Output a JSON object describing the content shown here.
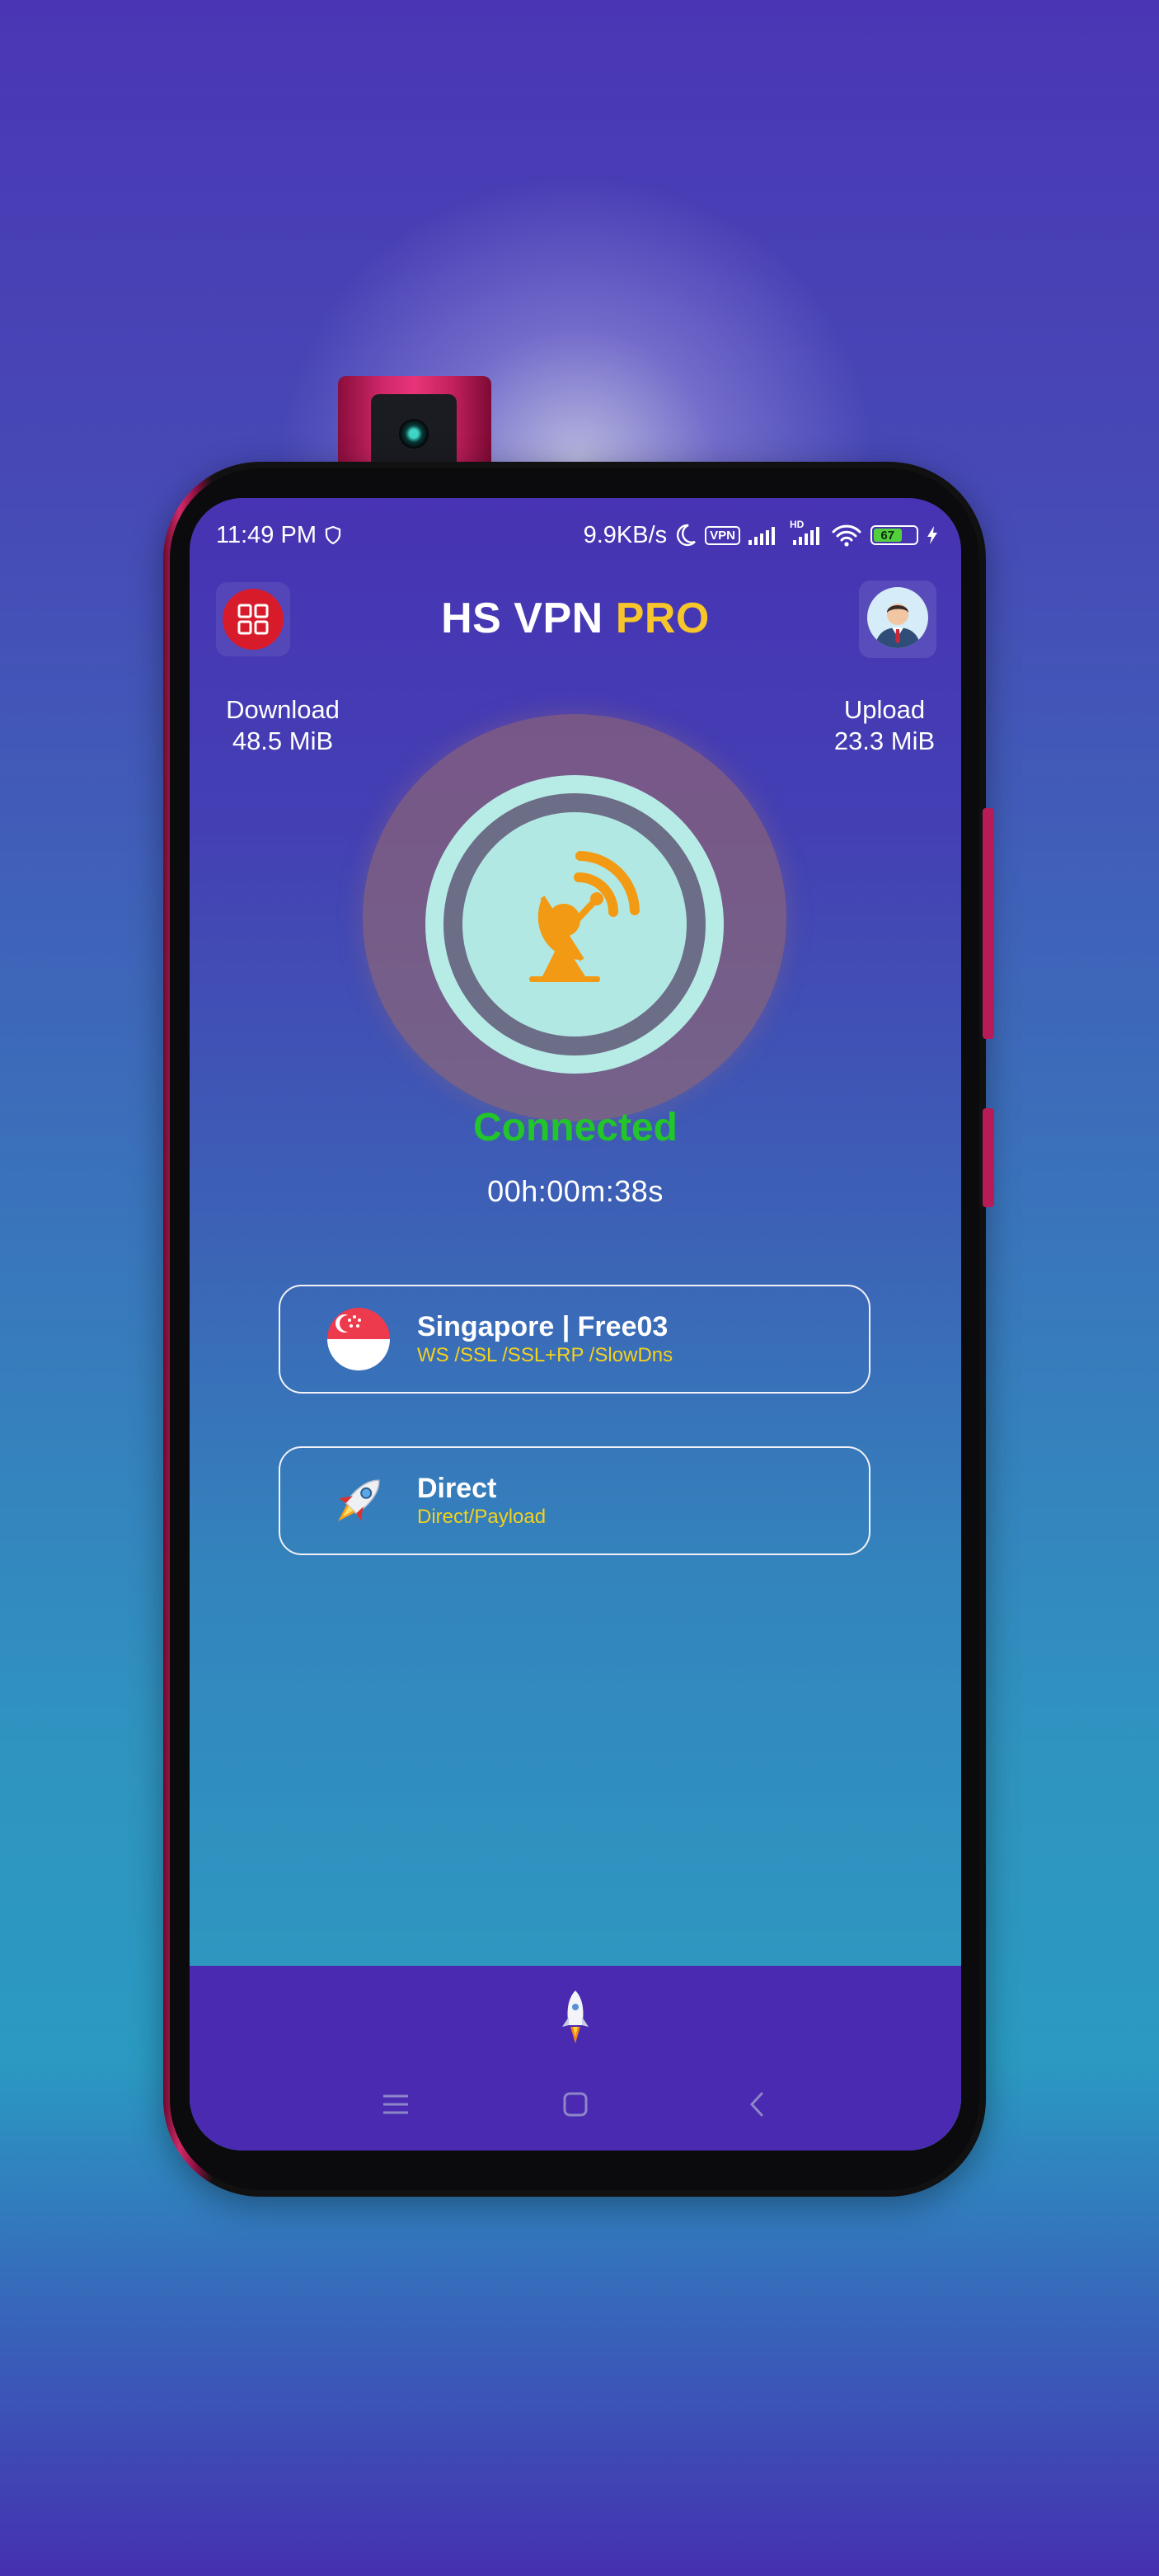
{
  "status_bar": {
    "time": "11:49 PM",
    "network_speed": "9.9KB/s",
    "vpn_badge": "VPN",
    "hd_label": "HD",
    "battery_level": "67"
  },
  "header": {
    "title_main": "HS VPN",
    "title_accent": "PRO"
  },
  "stats": {
    "download_label": "Download",
    "download_value": "48.5 MiB",
    "upload_label": "Upload",
    "upload_value": "23.3 MiB"
  },
  "connection": {
    "status": "Connected",
    "timer": "00h:00m:38s"
  },
  "server_card": {
    "name": "Singapore | Free03",
    "protocols": "WS /SSL /SSL+RP /SlowDns"
  },
  "mode_card": {
    "name": "Direct",
    "description": "Direct/Payload"
  },
  "colors": {
    "accent_yellow": "#f7c62a",
    "connected_green": "#22c52a",
    "menu_red": "#d81b2a",
    "dish_orange": "#f39a14",
    "nav_purple": "#4a2ab0"
  },
  "icons": {
    "menu": "grid-icon",
    "profile": "avatar-icon",
    "connect": "satellite-dish-icon",
    "server": "singapore-flag-icon",
    "mode": "rocket-icon",
    "nav_center": "rocket-icon"
  }
}
